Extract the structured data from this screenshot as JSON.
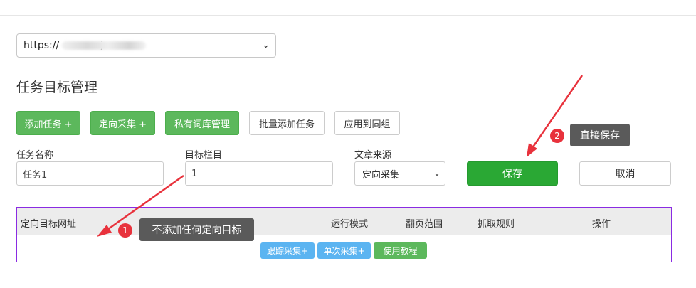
{
  "url_select": {
    "value_prefix": "https://",
    "value_suffix": "j"
  },
  "section_title": "任务目标管理",
  "toolbar": {
    "add_task": "添加任务 +",
    "directed_collect": "定向采集 +",
    "private_lexicon": "私有词库管理",
    "batch_add": "批量添加任务",
    "apply_group": "应用到同组"
  },
  "form": {
    "task_name_label": "任务名称",
    "task_name_value": "任务1",
    "target_column_label": "目标栏目",
    "target_column_value": "1",
    "source_label": "文章来源",
    "source_value": "定向采集",
    "save": "保存",
    "cancel": "取消"
  },
  "table": {
    "headers": [
      "定向目标网址",
      "运行模式",
      "翻页范围",
      "抓取规则",
      "操作"
    ],
    "buttons": {
      "track": "跟踪采集+",
      "single": "单次采集+",
      "tutorial": "使用教程"
    }
  },
  "annotations": [
    {
      "num": "1",
      "text": "不添加任何定向目标"
    },
    {
      "num": "2",
      "text": "直接保存"
    }
  ],
  "colors": {
    "green": "#5cb85c",
    "save_green": "#2aa834",
    "blue": "#5bb4f1",
    "arrow_red": "#e8323c",
    "panel_border": "#8a2be2"
  }
}
